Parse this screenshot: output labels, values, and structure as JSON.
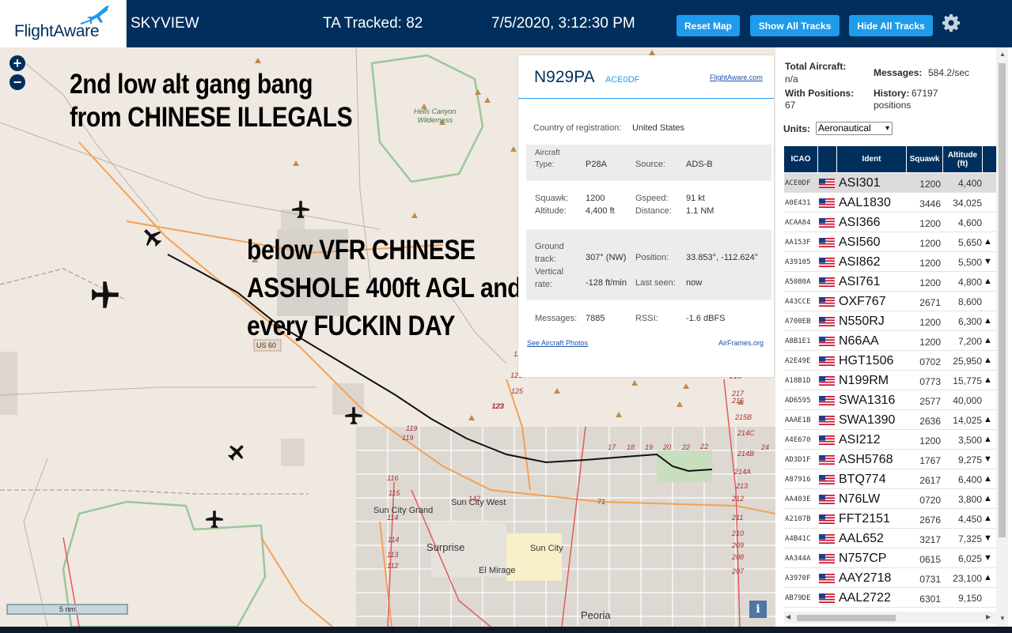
{
  "header": {
    "logo_text": "FlightAware",
    "site_name": "SKYVIEW",
    "ta_tracked": "TA Tracked: 82",
    "datetime": "7/5/2020, 3:12:30 PM",
    "reset_map": "Reset Map",
    "show_all_tracks": "Show All Tracks",
    "hide_all_tracks": "Hide All Tracks",
    "settings_icon": "gear-icon"
  },
  "map": {
    "zoom_in": "+",
    "zoom_out": "−",
    "annotation_top": [
      "2nd low alt gang bang",
      "from CHINESE ILLEGALS"
    ],
    "annotation_middle": [
      "below VFR CHINESE",
      "ASSHOLE 400ft AGL and BELOW",
      "every FUCKIN DAY"
    ],
    "scale_label": "5 nm",
    "info_button": "i",
    "labels": {
      "hells_canyon": "Hells Canyon\nWilderness",
      "us60": "US 60",
      "sun_city_west": "Sun City West",
      "sun_city_grand": "Sun City Grand",
      "surprise": "Surprise",
      "sun_city": "Sun City",
      "el_mirage": "El Mirage",
      "peoria": "Peoria"
    },
    "road_numbers": [
      "127",
      "126",
      "125",
      "125",
      "123",
      "123",
      "119",
      "119",
      "116",
      "115",
      "114",
      "114",
      "113",
      "112",
      "142",
      "17",
      "18",
      "19",
      "20",
      "22",
      "220",
      "219",
      "218",
      "217",
      "216",
      "215B",
      "214C",
      "214B",
      "214A",
      "213",
      "212",
      "211",
      "210",
      "209",
      "208",
      "207",
      "22",
      "24",
      "71"
    ],
    "colors": {
      "track": "#000000",
      "mountain": "#c08b4f",
      "road": "#f39c48"
    }
  },
  "popup": {
    "registration": "N929PA",
    "icao": "ACE0DF",
    "fa_link": "FlightAware.com",
    "country_label": "Country of registration:",
    "country": "United States",
    "aircraft_type_label": "Aircraft Type:",
    "aircraft_type": "P28A",
    "source_label": "Source:",
    "source": "ADS-B",
    "squawk_label": "Squawk:",
    "squawk": "1200",
    "gspeed_label": "Gspeed:",
    "gspeed": "91 kt",
    "altitude_label": "Altitude:",
    "altitude": "4,400 ft",
    "distance_label": "Distance:",
    "distance": "1.1 NM",
    "ground_track_label": "Ground track:",
    "ground_track": "307° (NW)",
    "position_label": "Position:",
    "position": "33.853°, -112.624°",
    "vertical_rate_label": "Vertical rate:",
    "vertical_rate": "-128 ft/min",
    "last_seen_label": "Last seen:",
    "last_seen": "now",
    "messages_label": "Messages:",
    "messages": "7885",
    "rssi_label": "RSSI:",
    "rssi": "-1.6 dBFS",
    "photos_link": "See Aircraft Photos",
    "airframes_link": "AirFrames.org"
  },
  "stats": {
    "total_aircraft_label": "Total Aircraft:",
    "total_aircraft": "n/a",
    "messages_label": "Messages:",
    "messages": "584.2/sec",
    "with_positions_label": "With Positions:",
    "with_positions": "67",
    "history_label": "History:",
    "history": "67197 positions",
    "units_label": "Units:",
    "units_value": "Aeronautical"
  },
  "table": {
    "headers": [
      "ICAO",
      "",
      "Ident",
      "Squawk",
      "Altitude (ft)",
      ""
    ],
    "rows": [
      {
        "icao": "ACE0DF",
        "ident": "ASI301",
        "squawk": "1200",
        "alt": "4,400",
        "trend": ""
      },
      {
        "icao": "A0E431",
        "ident": "AAL1830",
        "squawk": "3446",
        "alt": "34,025",
        "trend": ""
      },
      {
        "icao": "ACAA84",
        "ident": "ASI366",
        "squawk": "1200",
        "alt": "4,600",
        "trend": ""
      },
      {
        "icao": "AA153F",
        "ident": "ASI560",
        "squawk": "1200",
        "alt": "5,650",
        "trend": "▲"
      },
      {
        "icao": "A39105",
        "ident": "ASI862",
        "squawk": "1200",
        "alt": "5,500",
        "trend": "▼"
      },
      {
        "icao": "A5080A",
        "ident": "ASI761",
        "squawk": "1200",
        "alt": "4,800",
        "trend": "▲"
      },
      {
        "icao": "A43CCE",
        "ident": "OXF767",
        "squawk": "2671",
        "alt": "8,600",
        "trend": ""
      },
      {
        "icao": "A700EB",
        "ident": "N550RJ",
        "squawk": "1200",
        "alt": "6,300",
        "trend": "▲"
      },
      {
        "icao": "A8B1E1",
        "ident": "N66AA",
        "squawk": "1200",
        "alt": "7,200",
        "trend": "▲"
      },
      {
        "icao": "A2E49E",
        "ident": "HGT1506",
        "squawk": "0702",
        "alt": "25,950",
        "trend": "▲"
      },
      {
        "icao": "A18B1D",
        "ident": "N199RM",
        "squawk": "0773",
        "alt": "15,775",
        "trend": "▲"
      },
      {
        "icao": "AD6595",
        "ident": "SWA1316",
        "squawk": "2577",
        "alt": "40,000",
        "trend": ""
      },
      {
        "icao": "AAAE1B",
        "ident": "SWA1390",
        "squawk": "2636",
        "alt": "14,025",
        "trend": "▲"
      },
      {
        "icao": "A4E670",
        "ident": "ASI212",
        "squawk": "1200",
        "alt": "3,500",
        "trend": "▲"
      },
      {
        "icao": "AD3D1F",
        "ident": "ASH5768",
        "squawk": "1767",
        "alt": "9,275",
        "trend": "▼"
      },
      {
        "icao": "A87916",
        "ident": "BTQ774",
        "squawk": "2617",
        "alt": "6,400",
        "trend": "▲"
      },
      {
        "icao": "AA403E",
        "ident": "N76LW",
        "squawk": "0720",
        "alt": "3,800",
        "trend": "▲"
      },
      {
        "icao": "A2107B",
        "ident": "FFT2151",
        "squawk": "2676",
        "alt": "4,450",
        "trend": "▲"
      },
      {
        "icao": "A4B41C",
        "ident": "AAL652",
        "squawk": "3217",
        "alt": "7,325",
        "trend": "▼"
      },
      {
        "icao": "AA344A",
        "ident": "N757CP",
        "squawk": "0615",
        "alt": "6,025",
        "trend": "▼"
      },
      {
        "icao": "A3970F",
        "ident": "AAY2718",
        "squawk": "0731",
        "alt": "23,100",
        "trend": "▲"
      },
      {
        "icao": "AB79DE",
        "ident": "AAL2722",
        "squawk": "6301",
        "alt": "9,150",
        "trend": ""
      }
    ]
  }
}
